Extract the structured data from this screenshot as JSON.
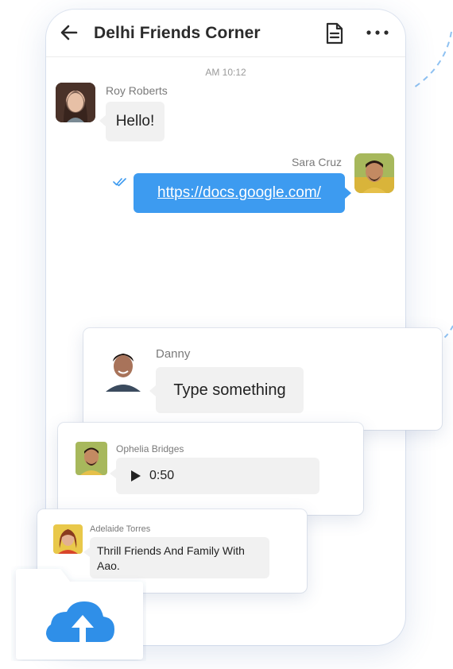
{
  "header": {
    "title": "Delhi Friends Corner",
    "back_icon": "arrow-left-icon",
    "doc_icon": "document-icon",
    "more_icon": "more-horizontal-icon"
  },
  "chat": {
    "timestamp": "AM 10:12",
    "messages": [
      {
        "sender": "Roy Roberts",
        "text": "Hello!",
        "direction": "incoming"
      },
      {
        "sender": "Sara Cruz",
        "text": "https://docs.google.com/",
        "direction": "outgoing",
        "status_icon": "double-check-icon"
      }
    ]
  },
  "cards": [
    {
      "sender": "Danny",
      "text": "Type something"
    },
    {
      "sender": "Ophelia Bridges",
      "audio_duration": "0:50",
      "play_icon": "play-icon"
    },
    {
      "sender": "Adelaide Torres",
      "text": "Thrill Friends And Family With Aao."
    }
  ],
  "upload": {
    "icon": "cloud-upload-icon"
  },
  "colors": {
    "accent": "#3d9bf0",
    "bubble": "#f1f1f1",
    "upload_cloud": "#2f8fe8"
  }
}
